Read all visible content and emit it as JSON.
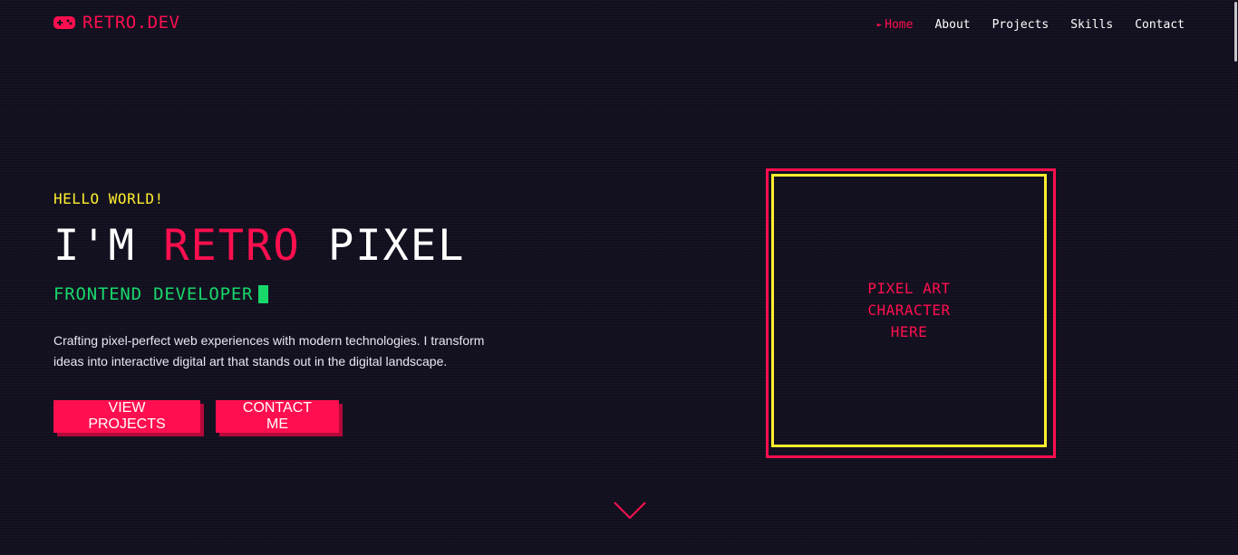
{
  "brand": {
    "name": "RETRO.DEV",
    "icon": "gamepad-icon",
    "accent_color": "#ff0f4f"
  },
  "nav": {
    "items": [
      {
        "label": "Home",
        "active": true
      },
      {
        "label": "About",
        "active": false
      },
      {
        "label": "Projects",
        "active": false
      },
      {
        "label": "Skills",
        "active": false
      },
      {
        "label": "Contact",
        "active": false
      }
    ],
    "active_marker": "►"
  },
  "hero": {
    "greeting": "HELLO WORLD!",
    "headline_prefix": "I'M",
    "headline_accent": "RETRO",
    "headline_suffix": "PIXEL",
    "role": "FRONTEND DEVELOPER",
    "description": "Crafting pixel-perfect web experiences with modern technologies. I transform ideas into interactive digital art that stands out in the digital landscape.",
    "primary_button": "VIEW PROJECTS",
    "secondary_button": "CONTACT ME"
  },
  "art": {
    "placeholder": "PIXEL ART CHARACTER HERE",
    "outer_border_color": "#ff0f4f",
    "inner_border_color": "#ffee2e"
  },
  "scroll_indicator": {
    "icon": "chevron-down-icon"
  },
  "colors": {
    "background": "#12101f",
    "primary": "#ff0f4f",
    "yellow": "#ffee2e",
    "green": "#18d86b"
  }
}
